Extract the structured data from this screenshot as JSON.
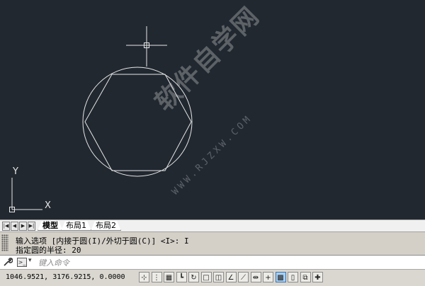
{
  "layout_tabs": [
    {
      "label": "模型",
      "active": true
    },
    {
      "label": "布局1",
      "active": false
    },
    {
      "label": "布局2",
      "active": false
    }
  ],
  "command_history": [
    "输入选项 [内接于圆(I)/外切于圆(C)] <I>: I",
    "指定圆的半径: 20"
  ],
  "command_input": {
    "placeholder": "键入命令"
  },
  "status": {
    "coordinates": "1046.9521, 3176.9215, 0.0000"
  },
  "ucs": {
    "x_label": "X",
    "y_label": "Y"
  },
  "watermark": {
    "text": "软件自学网",
    "url": "WWW.RJZXW.COM"
  },
  "colors": {
    "canvas_bg": "#212830",
    "drawing_line": "#e6e6e6",
    "toggle_on": "#a9cff0"
  },
  "status_toggles": [
    {
      "name": "infer-constraints-icon",
      "glyph": "⊹",
      "on": false
    },
    {
      "name": "snap-mode-icon",
      "glyph": "⋮",
      "on": false
    },
    {
      "name": "grid-display-icon",
      "glyph": "▦",
      "on": false
    },
    {
      "name": "ortho-mode-icon",
      "glyph": "┗",
      "on": false
    },
    {
      "name": "polar-tracking-icon",
      "glyph": "↻",
      "on": false
    },
    {
      "name": "object-snap-icon",
      "glyph": "□",
      "on": false
    },
    {
      "name": "3d-object-snap-icon",
      "glyph": "◫",
      "on": false
    },
    {
      "name": "object-snap-tracking-icon",
      "glyph": "∠",
      "on": false
    },
    {
      "name": "dynamic-ucs-icon",
      "glyph": "⟋",
      "on": false
    },
    {
      "name": "dynamic-input-icon",
      "glyph": "⇹",
      "on": false
    },
    {
      "name": "lineweight-icon",
      "glyph": "+",
      "on": false
    },
    {
      "name": "transparency-icon",
      "glyph": "▩",
      "on": true
    },
    {
      "name": "quick-properties-icon",
      "glyph": "▯",
      "on": false
    },
    {
      "name": "selection-cycling-icon",
      "glyph": "⧉",
      "on": false
    },
    {
      "name": "annotation-monitor-icon",
      "glyph": "✚",
      "on": false
    }
  ]
}
